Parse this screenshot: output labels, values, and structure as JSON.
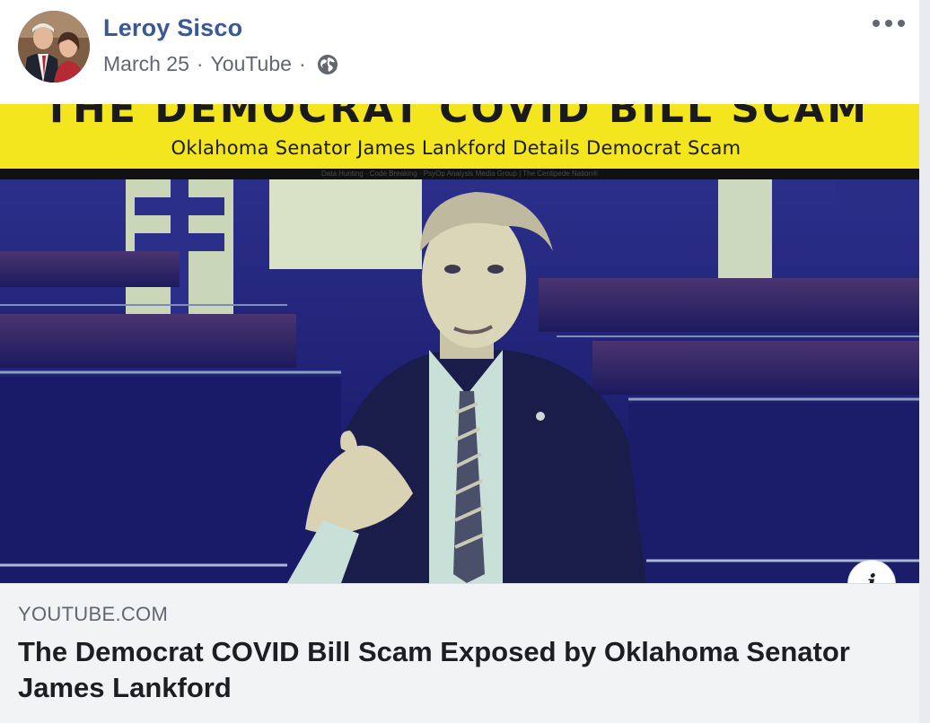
{
  "post": {
    "author": "Leroy Sisco",
    "date": "March 25",
    "separator": "·",
    "source": "YouTube",
    "privacy_icon": "globe-icon",
    "more_icon": "more-options-icon"
  },
  "thumbnail": {
    "headline": "THE DEMOCRAT COVID BILL SCAM",
    "subheadline": "Oklahoma Senator James Lankford Details Democrat Scam",
    "credit": "Data Hunting · Code Breaking · PsyOp Analysis Media Group | The Centipede Nation®",
    "colors": {
      "banner": "#f4e61e",
      "scene": "#1e1f6e"
    }
  },
  "info_button": {
    "label": "i"
  },
  "link": {
    "domain": "YOUTUBE.COM",
    "title": "The Democrat COVID Bill Scam Exposed by Oklahoma Senator James Lankford"
  },
  "colors": {
    "author": "#385898",
    "meta": "#606770",
    "link_bg": "#f2f3f5"
  }
}
